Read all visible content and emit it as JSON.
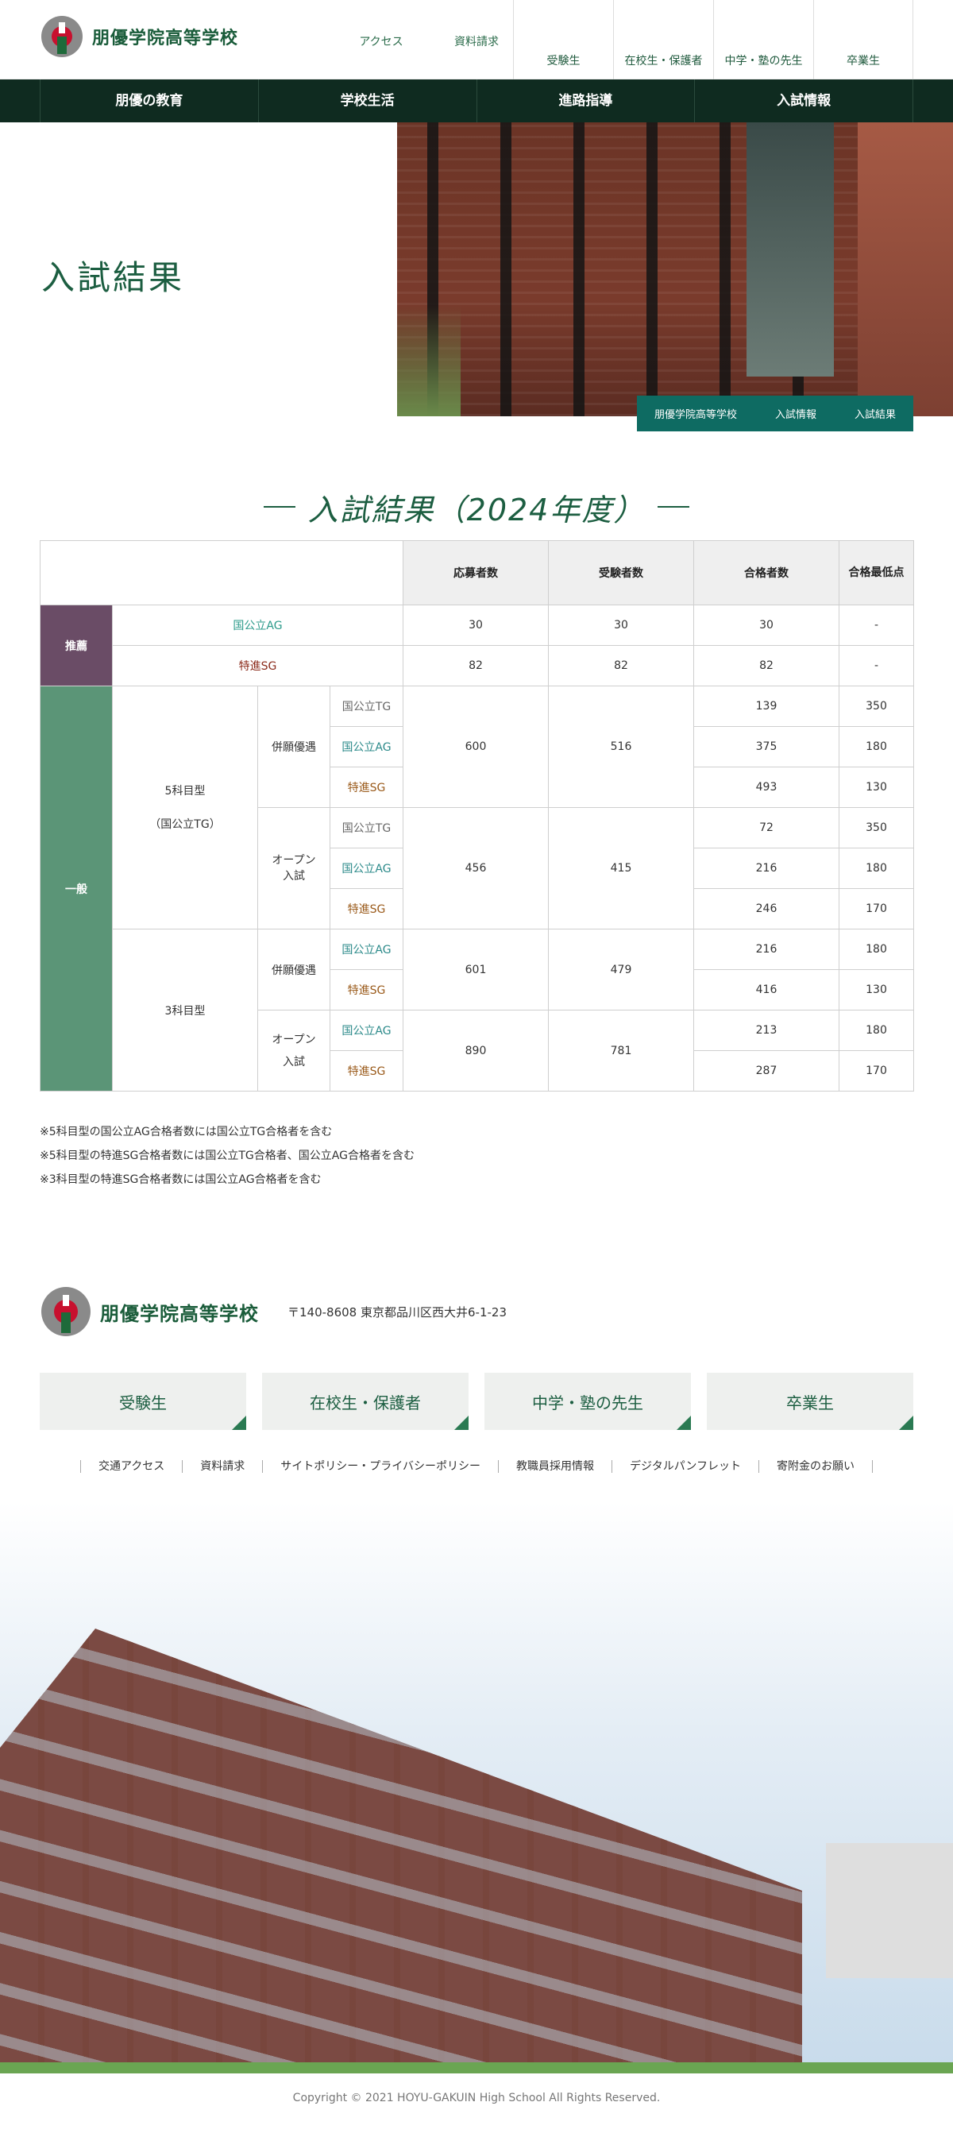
{
  "header": {
    "logo_text": "朋優学院高等学校",
    "util_links": [
      "アクセス",
      "資料請求"
    ],
    "targets": [
      "受験生",
      "在校生・保護者",
      "中学・塾の先生",
      "卒業生"
    ]
  },
  "gnav": [
    "朋優の教育",
    "学校生活",
    "進路指導",
    "入試情報"
  ],
  "hero": {
    "title": "入試結果",
    "breadcrumb": [
      "朋優学院高等学校",
      "入試情報",
      "入試結果"
    ]
  },
  "section_title": "入試結果（2024年度）",
  "table": {
    "headers": [
      "応募者数",
      "受験者数",
      "合格者数",
      "合格最低点"
    ],
    "recommend": {
      "label": "推薦",
      "rows": [
        {
          "course": "国公立AG",
          "applicants": "30",
          "examinees": "30",
          "passed": "30",
          "min": "-"
        },
        {
          "course": "特進SG",
          "applicants": "82",
          "examinees": "82",
          "passed": "82",
          "min": "-"
        }
      ]
    },
    "general": {
      "label": "一般",
      "type5": {
        "label_line1": "5科目型",
        "label_line2": "（国公立TG）"
      },
      "type3": {
        "label": "3科目型"
      },
      "heigan": "併願優遇",
      "open_line1": "オープン",
      "open_line2": "入試",
      "blocks": [
        {
          "applicants": "600",
          "examinees": "516",
          "rows": [
            {
              "course": "国公立TG",
              "passed": "139",
              "min": "350"
            },
            {
              "course": "国公立AG",
              "passed": "375",
              "min": "180"
            },
            {
              "course": "特進SG",
              "passed": "493",
              "min": "130"
            }
          ]
        },
        {
          "applicants": "456",
          "examinees": "415",
          "rows": [
            {
              "course": "国公立TG",
              "passed": "72",
              "min": "350"
            },
            {
              "course": "国公立AG",
              "passed": "216",
              "min": "180"
            },
            {
              "course": "特進SG",
              "passed": "246",
              "min": "170"
            }
          ]
        },
        {
          "applicants": "601",
          "examinees": "479",
          "rows": [
            {
              "course": "国公立AG",
              "passed": "216",
              "min": "180"
            },
            {
              "course": "特進SG",
              "passed": "416",
              "min": "130"
            }
          ]
        },
        {
          "applicants": "890",
          "examinees": "781",
          "rows": [
            {
              "course": "国公立AG",
              "passed": "213",
              "min": "180"
            },
            {
              "course": "特進SG",
              "passed": "287",
              "min": "170"
            }
          ]
        }
      ]
    }
  },
  "notes": [
    "※5科目型の国公立AG合格者数には国公立TG合格者を含む",
    "※5科目型の特進SG合格者数には国公立TG合格者、国公立AG合格者を含む",
    "※3科目型の特進SG合格者数には国公立AG合格者を含む"
  ],
  "footer": {
    "logo_text": "朋優学院高等学校",
    "address": "〒140-8608 東京都品川区西大井6-1-23",
    "targets": [
      "受験生",
      "在校生・保護者",
      "中学・塾の先生",
      "卒業生"
    ],
    "links": [
      "交通アクセス",
      "資料請求",
      "サイトポリシー・プライバシーポリシー",
      "教職員採用情報",
      "デジタルパンフレット",
      "寄附金のお願い"
    ],
    "copyright": "Copyright © 2021 HOYU-GAKUIN High School All Rights Reserved."
  },
  "colors": {
    "brand_green": "#1c5e41",
    "nav_dark": "#0f2b20",
    "breadcrumb_teal": "#0e6b62",
    "recommend_purple": "#6a4c66",
    "general_green": "#5b9577"
  }
}
